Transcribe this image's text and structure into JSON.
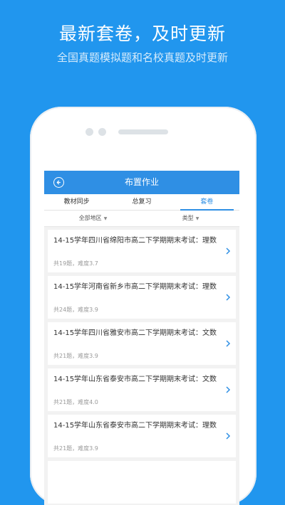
{
  "promo": {
    "title": "最新套卷，及时更新",
    "subtitle": "全国真题模拟题和名校真题及时更新"
  },
  "appbar": {
    "title": "布置作业"
  },
  "tabs": [
    {
      "label": "教材同步",
      "active": false
    },
    {
      "label": "总复习",
      "active": false
    },
    {
      "label": "套卷",
      "active": true
    }
  ],
  "filters": {
    "region": "全部地区",
    "type": "类型"
  },
  "papers": [
    {
      "title": "14-15学年四川省绵阳市高二下学期期末考试：理数",
      "meta": "共19题，难度3.7"
    },
    {
      "title": "14-15学年河南省新乡市高二下学期期末考试：理数",
      "meta": "共24题，难度3.9"
    },
    {
      "title": "14-15学年四川省雅安市高二下学期期末考试：文数",
      "meta": "共21题，难度3.9"
    },
    {
      "title": "14-15学年山东省泰安市高二下学期期末考试：文数",
      "meta": "共21题，难度4.0"
    },
    {
      "title": "14-15学年山东省泰安市高二下学期期末考试：理数",
      "meta": "共21题，难度3.9"
    }
  ],
  "colors": {
    "background": "#2196ee",
    "accent": "#2f8fe4"
  }
}
